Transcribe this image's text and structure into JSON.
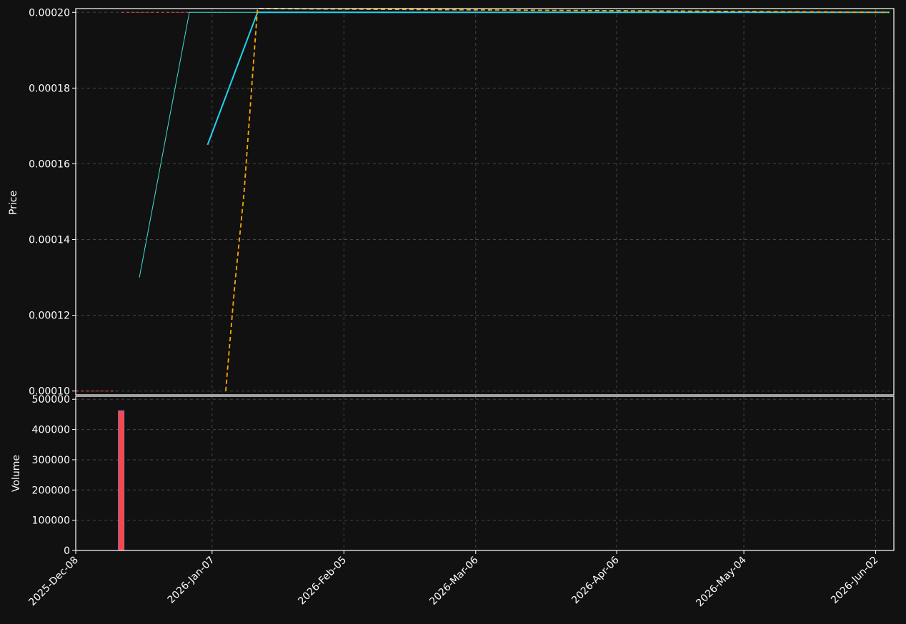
{
  "colors": {
    "background": "#111111",
    "axis": "#ffffff",
    "grid": "#444444",
    "close_line": "#22d3ee",
    "thin_line": "#40e0d0",
    "ema_line": "#ffa500",
    "ref_line": "#ff4d4d",
    "volume_bar": "#ff4444"
  },
  "chart_data": [
    {
      "type": "line",
      "panel": "price",
      "xlabel": "",
      "ylabel": "Price",
      "x_type": "date",
      "xlim": [
        "2025-12-08",
        "2026-06-06"
      ],
      "ylim": [
        9.9e-05,
        0.000201
      ],
      "yticks": [
        0.0001,
        0.00012,
        0.00014,
        0.00016,
        0.00018,
        0.0002
      ],
      "ytick_labels": [
        "0.00010",
        "0.00012",
        "0.00014",
        "0.00016",
        "0.00018",
        "0.00020"
      ],
      "grid": true,
      "series": [
        {
          "style": "thin",
          "x": [
            "2025-12-22",
            "2026-01-02",
            "2026-01-17",
            "2026-06-05"
          ],
          "y": [
            0.00013,
            0.0002,
            0.0002,
            0.0002
          ]
        },
        {
          "style": "solid",
          "x": [
            "2026-01-06",
            "2026-01-17",
            "2026-06-05"
          ],
          "y": [
            0.000165,
            0.0002,
            0.0002
          ]
        },
        {
          "style": "dashed",
          "x": [
            "2026-01-10",
            "2026-01-12",
            "2026-01-14",
            "2026-01-16",
            "2026-01-17",
            "2026-06-05"
          ],
          "y": [
            0.0001,
            0.000128,
            0.000152,
            0.000185,
            0.000201,
            0.0002
          ]
        },
        {
          "style": "ref-dashed",
          "x": [
            "2025-12-08",
            "2025-12-17"
          ],
          "y": [
            0.0001,
            0.0001
          ]
        },
        {
          "style": "ref-dashed",
          "x": [
            "2025-12-18",
            "2026-01-02"
          ],
          "y": [
            0.0002,
            0.0002
          ]
        }
      ]
    },
    {
      "type": "bar",
      "panel": "volume",
      "xlabel": "",
      "ylabel": "Volume",
      "x_type": "date",
      "xlim": [
        "2025-12-08",
        "2026-06-06"
      ],
      "ylim": [
        0,
        510000
      ],
      "yticks": [
        0,
        100000,
        200000,
        300000,
        400000,
        500000
      ],
      "ytick_labels": [
        "0",
        "100000",
        "200000",
        "300000",
        "400000",
        "500000"
      ],
      "grid": true,
      "bars": [
        {
          "x": "2025-12-18",
          "value": 462000
        }
      ],
      "xticks": [
        "2025-12-08",
        "2026-01-07",
        "2026-02-05",
        "2026-03-06",
        "2026-04-06",
        "2026-05-04",
        "2026-06-02"
      ],
      "xtick_labels": [
        "2025-Dec-08",
        "2026-Jan-07",
        "2026-Feb-05",
        "2026-Mar-06",
        "2026-Apr-06",
        "2026-May-04",
        "2026-Jun-02"
      ]
    }
  ]
}
